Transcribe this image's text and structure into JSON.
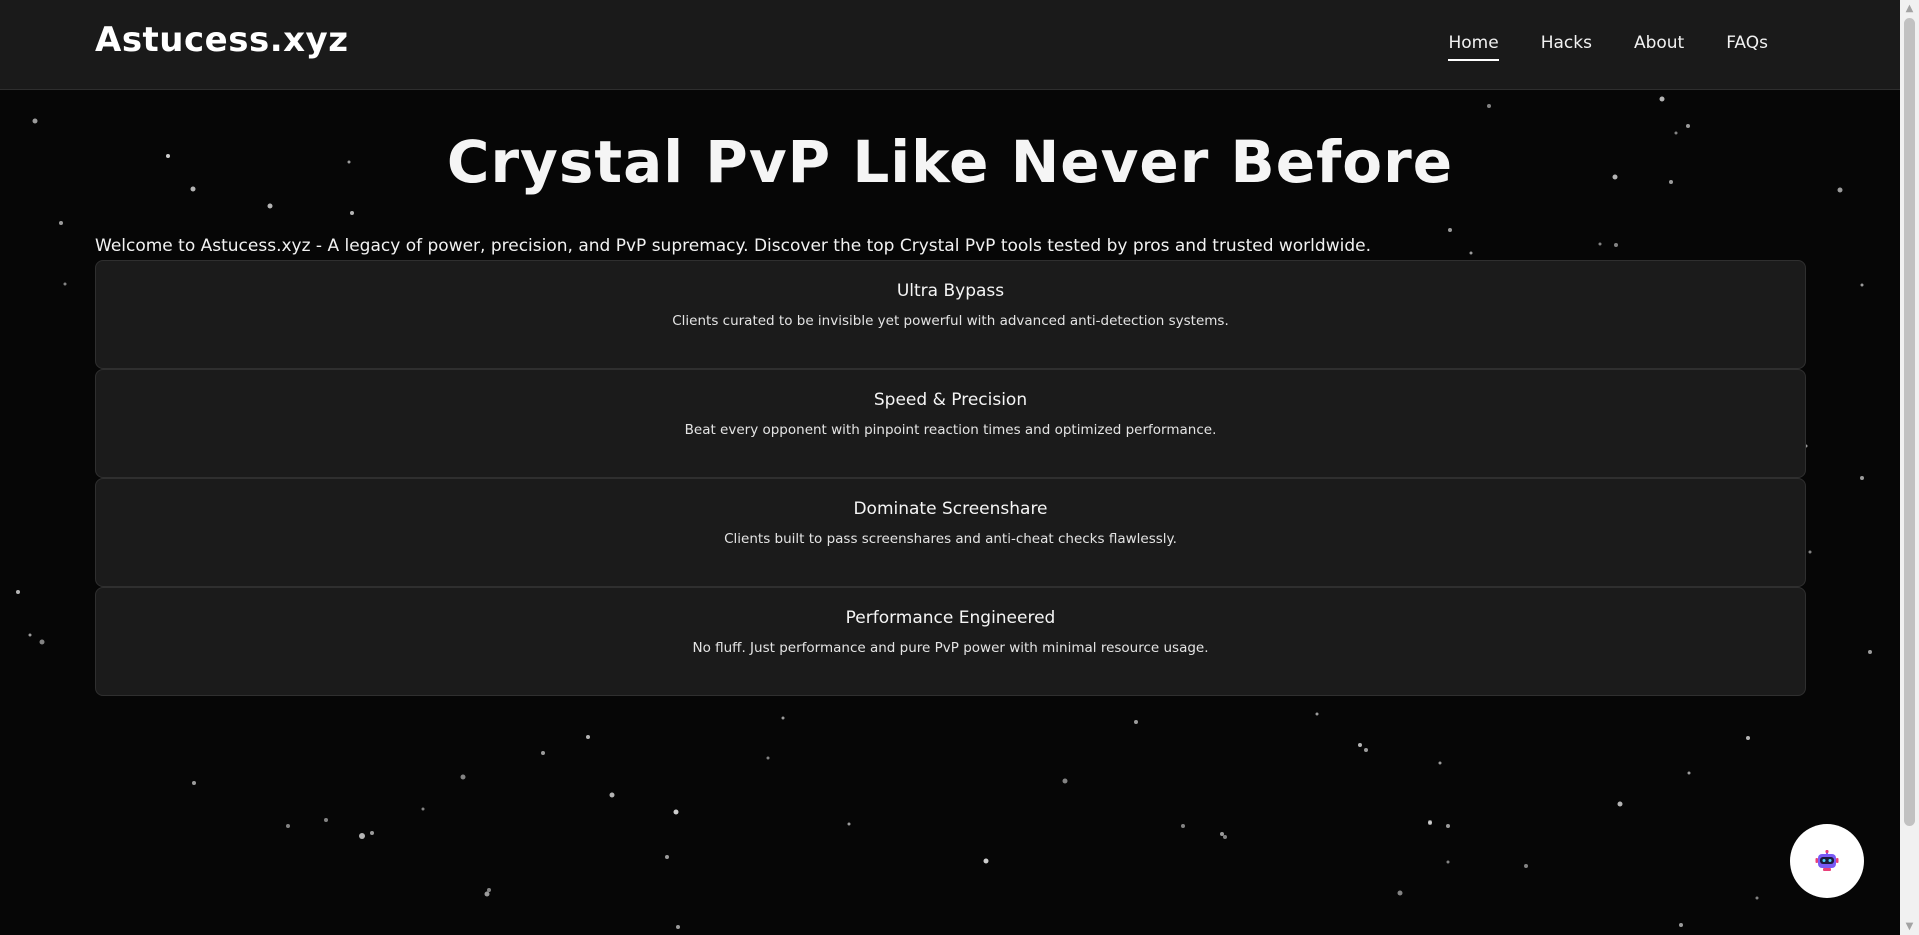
{
  "header": {
    "logo": "Astucess.xyz",
    "nav": [
      {
        "label": "Home",
        "active": true
      },
      {
        "label": "Hacks",
        "active": false
      },
      {
        "label": "About",
        "active": false
      },
      {
        "label": "FAQs",
        "active": false
      }
    ]
  },
  "hero": {
    "title": "Crystal PvP Like Never Before",
    "intro": "Welcome to Astucess.xyz - A legacy of power, precision, and PvP supremacy. Discover the top Crystal PvP tools tested by pros and trusted worldwide."
  },
  "features": [
    {
      "title": "Ultra Bypass",
      "description": "Clients curated to be invisible yet powerful with advanced anti-detection systems."
    },
    {
      "title": "Speed & Precision",
      "description": "Beat every opponent with pinpoint reaction times and optimized performance."
    },
    {
      "title": "Dominate Screenshare",
      "description": "Clients built to pass screenshares and anti-cheat checks flawlessly."
    },
    {
      "title": "Performance Engineered",
      "description": "No fluff. Just performance and pure PvP power with minimal resource usage."
    }
  ],
  "chat_widget": {
    "icon": "robot-icon"
  },
  "colors": {
    "background": "#060606",
    "navbar": "#1a1a1a",
    "card": "#1b1b1b",
    "text": "#f2f2f2"
  }
}
